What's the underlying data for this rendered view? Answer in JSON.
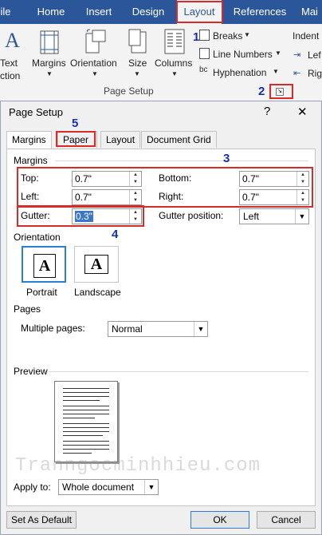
{
  "ribbon": {
    "tabs": [
      "ile",
      "Home",
      "Insert",
      "Design",
      "Layout",
      "References",
      "Mai"
    ],
    "buttons": {
      "text_direction": [
        "Text",
        "ction"
      ],
      "margins": "Margins",
      "orientation": "Orientation",
      "size": "Size",
      "columns": "Columns"
    },
    "breaks": "Breaks",
    "line_numbers": "Line Numbers",
    "hyphenation": "Hyphenation",
    "indent_label": "Indent",
    "indent_left": "Lef",
    "indent_right": "Rig",
    "group_name": "Page Setup"
  },
  "annotations": [
    "1",
    "2",
    "3",
    "4",
    "5"
  ],
  "dialog": {
    "title": "Page Setup",
    "help": "?",
    "close": "✕",
    "tabs": [
      "Margins",
      "Paper",
      "Layout",
      "Document Grid"
    ],
    "margins_section": "Margins",
    "fields": {
      "top_label": "Top:",
      "top_value": "0.7\"",
      "bottom_label": "Bottom:",
      "bottom_value": "0.7\"",
      "left_label": "Left:",
      "left_value": "0.7\"",
      "right_label": "Right:",
      "right_value": "0.7\"",
      "gutter_label": "Gutter:",
      "gutter_value": "0.3\"",
      "gutter_position_label": "Gutter position:",
      "gutter_position_value": "Left"
    },
    "orientation_section": "Orientation",
    "portrait": "Portrait",
    "landscape": "Landscape",
    "pages_section": "Pages",
    "multiple_pages_label": "Multiple pages:",
    "multiple_pages_value": "Normal",
    "preview_section": "Preview",
    "watermark": "Tranngocminhhieu.com",
    "apply_to_label": "Apply to:",
    "apply_to_value": "Whole document",
    "set_default": "Set As Default",
    "ok": "OK",
    "cancel": "Cancel"
  },
  "colors": {
    "ribbon_blue": "#2b579a",
    "annotation_red": "#d62b2b",
    "annotation_number": "#1a2fb0"
  }
}
